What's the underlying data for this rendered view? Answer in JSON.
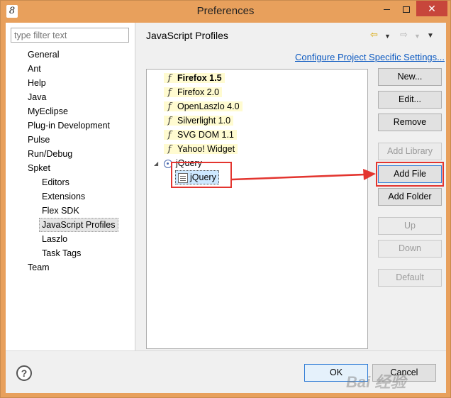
{
  "window": {
    "title": "Preferences",
    "icon_glyph": "8",
    "close_glyph": "✕"
  },
  "nav": {
    "filter_placeholder": "type filter text",
    "items": [
      {
        "label": "General",
        "level": 0
      },
      {
        "label": "Ant",
        "level": 0
      },
      {
        "label": "Help",
        "level": 0
      },
      {
        "label": "Java",
        "level": 0
      },
      {
        "label": "MyEclipse",
        "level": 0
      },
      {
        "label": "Plug-in Development",
        "level": 0
      },
      {
        "label": "Pulse",
        "level": 0
      },
      {
        "label": "Run/Debug",
        "level": 0
      },
      {
        "label": "Spket",
        "level": 0
      },
      {
        "label": "Editors",
        "level": 1
      },
      {
        "label": "Extensions",
        "level": 1
      },
      {
        "label": "Flex SDK",
        "level": 1
      },
      {
        "label": "JavaScript Profiles",
        "level": 1,
        "selected": true
      },
      {
        "label": "Laszlo",
        "level": 1
      },
      {
        "label": "Task Tags",
        "level": 1
      },
      {
        "label": "Team",
        "level": 0
      }
    ]
  },
  "page": {
    "title": "JavaScript Profiles",
    "config_link": "Configure Project Specific Settings...",
    "back_icon": "back-arrow-icon",
    "forward_icon": "forward-arrow-icon"
  },
  "profiles": [
    {
      "label": "Firefox 1.5",
      "bold": true,
      "icon": "f-function-icon"
    },
    {
      "label": "Firefox 2.0",
      "icon": "f-function-icon"
    },
    {
      "label": "OpenLaszlo 4.0",
      "icon": "f-function-icon"
    },
    {
      "label": "Silverlight 1.0",
      "icon": "f-function-icon"
    },
    {
      "label": "SVG DOM 1.1",
      "icon": "f-function-icon"
    },
    {
      "label": "Yahoo! Widget",
      "icon": "f-function-icon"
    },
    {
      "label": "jQuery",
      "icon": "library-icon",
      "expanded": true
    }
  ],
  "library_file": {
    "label": "jQuery",
    "icon": "file-icon"
  },
  "buttons": {
    "new": "New...",
    "edit": "Edit...",
    "remove": "Remove",
    "add_library": "Add Library",
    "add_file": "Add File",
    "add_folder": "Add Folder",
    "up": "Up",
    "down": "Down",
    "default": "Default"
  },
  "dialog": {
    "ok": "OK",
    "cancel": "Cancel",
    "help_glyph": "?"
  },
  "watermark": "Bai 经验",
  "colors": {
    "annotation": "#e3352f",
    "link": "#0a58c0",
    "highlight": "#fffbd0"
  }
}
